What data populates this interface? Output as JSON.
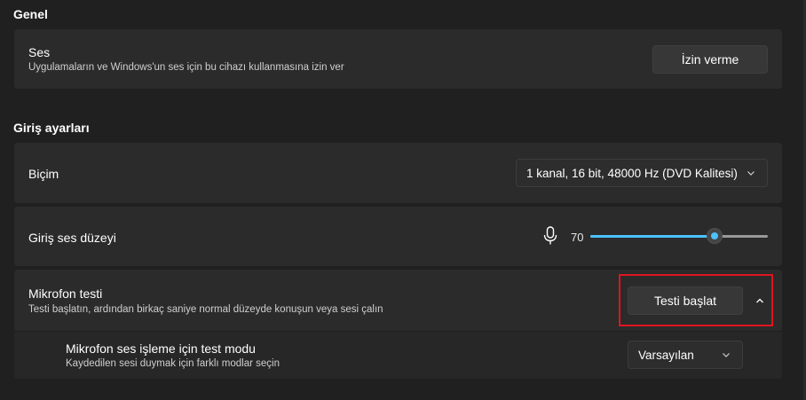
{
  "general": {
    "section_title": "Genel",
    "sound": {
      "title": "Ses",
      "description": "Uygulamaların ve Windows'un ses için bu cihazı kullanmasına izin ver",
      "button_label": "İzin verme"
    }
  },
  "input": {
    "section_title": "Giriş ayarları",
    "format": {
      "title": "Biçim",
      "selected": "1 kanal, 16 bit, 48000 Hz (DVD Kalitesi)"
    },
    "volume": {
      "title": "Giriş ses düzeyi",
      "value": "70",
      "level_percent": 70
    },
    "mic_test": {
      "title": "Mikrofon testi",
      "description": "Testi başlatın, ardından birkaç saniye normal düzeyde konuşun veya sesi çalın",
      "button_label": "Testi başlat"
    },
    "test_mode": {
      "title": "Mikrofon ses işleme için test modu",
      "description": "Kaydedilen sesi duymak için farklı modlar seçin",
      "selected": "Varsayılan"
    }
  },
  "colors": {
    "accent": "#4cc2ff",
    "highlight": "#e0141e"
  },
  "icons": {
    "microphone": "microphone-icon",
    "chevron_down": "chevron-down-icon",
    "chevron_up": "chevron-up-icon"
  }
}
